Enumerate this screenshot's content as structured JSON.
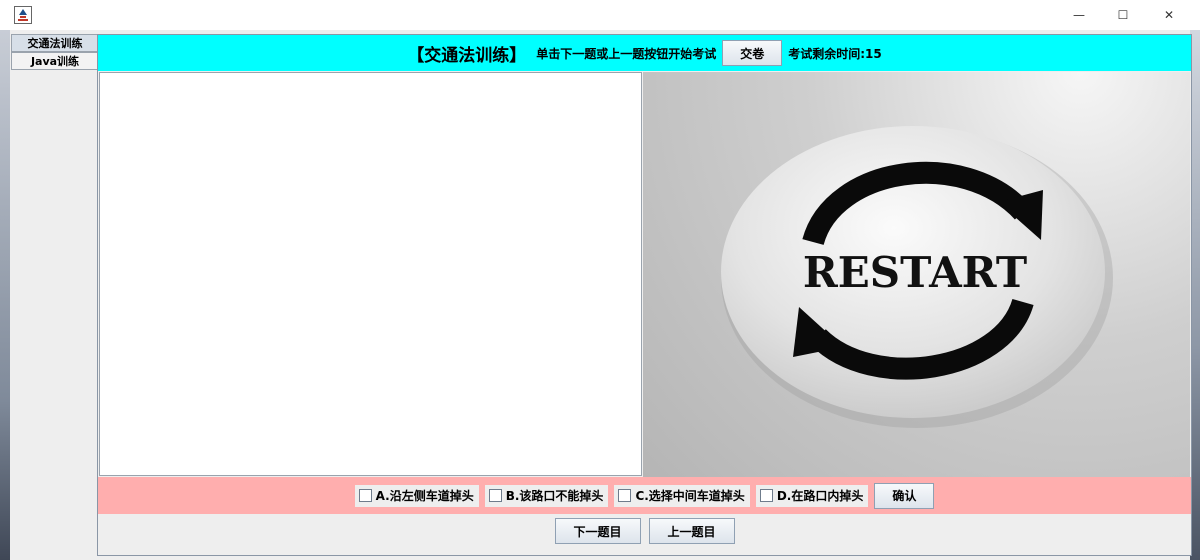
{
  "window": {
    "minimize": "—",
    "maximize": "☐",
    "close": "✕"
  },
  "tabs": [
    {
      "label": "交通法训练"
    },
    {
      "label": "Java训练"
    }
  ],
  "header": {
    "title": "【交通法训练】",
    "hint": "单击下一题或上一题按钮开始考试",
    "submit_label": "交卷",
    "timer_label": "考试剩余时间:15"
  },
  "image": {
    "text": "RESTART",
    "icon": "restart-icon"
  },
  "options": [
    {
      "label": "A.沿左侧车道掉头"
    },
    {
      "label": "B.该路口不能掉头"
    },
    {
      "label": "C.选择中间车道掉头"
    },
    {
      "label": "D.在路口内掉头"
    }
  ],
  "confirm_label": "确认",
  "nav": {
    "next_label": "下一题目",
    "prev_label": "上一题目"
  }
}
